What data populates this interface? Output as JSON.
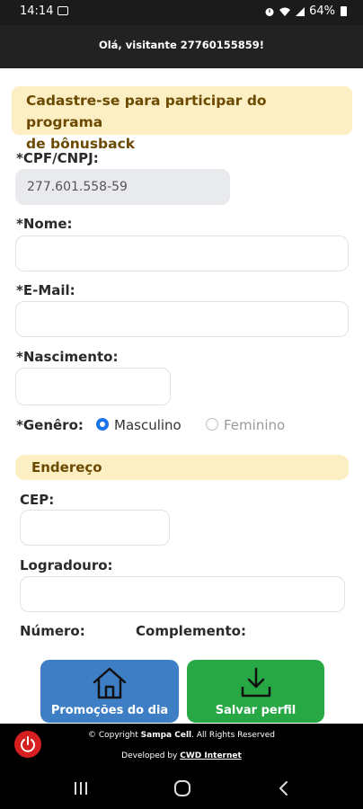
{
  "status_bar": {
    "time": "14:14",
    "battery": "64%"
  },
  "header": {
    "greeting": "Olá, visitante 27760155859!"
  },
  "banner": {
    "line1": "Cadastre-se para participar do programa",
    "line2": "de bônusback"
  },
  "form": {
    "cpf_label": "*CPF/CNPJ:",
    "cpf_value": "277.601.558-59",
    "nome_label": "*Nome:",
    "email_label": "*E-Mail:",
    "nascimento_label": "*Nascimento:",
    "genero_label": "*Genêro:",
    "genero_options": [
      "Masculino",
      "Feminino"
    ],
    "genero_selected": "Masculino"
  },
  "address": {
    "section_title": "Endereço",
    "cep_label": "CEP:",
    "logradouro_label": "Logradouro:",
    "numero_label": "Número:",
    "complemento_label": "Complemento:"
  },
  "actions": {
    "promocoes_label": "Promoções do dia",
    "salvar_label": "Salvar perfil"
  },
  "footer": {
    "copyright_prefix": "© Copyright",
    "brand": "Sampa Cell",
    "rights": ". All Rights Reserved",
    "developed_by": "Developed by",
    "developer": "CWD Internet"
  },
  "colors": {
    "banner_bg": "#fdefc4",
    "blue_button": "#3d7ec4",
    "green_button": "#28a745",
    "radio_accent": "#1a73e8",
    "power_red": "#d61f1f"
  },
  "icons": [
    "image-icon",
    "alarm-icon",
    "wifi-icon",
    "signal-icon",
    "battery-icon",
    "house-icon",
    "download-icon",
    "power-icon",
    "recent-apps-icon",
    "home-nav-icon",
    "back-nav-icon"
  ]
}
